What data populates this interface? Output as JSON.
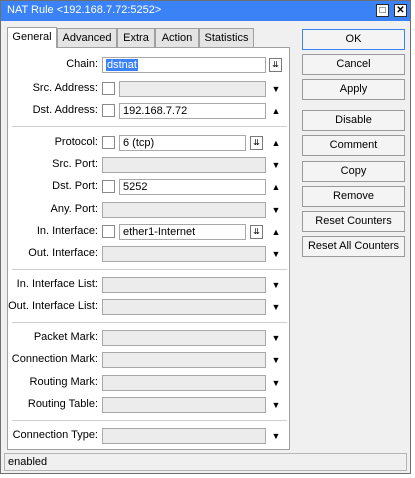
{
  "window": {
    "title": "NAT Rule <192.168.7.72:5252>",
    "restore_glyph": "□",
    "close_glyph": "✕"
  },
  "tabs": [
    "General",
    "Advanced",
    "Extra",
    "Action",
    "Statistics"
  ],
  "form": {
    "chain": {
      "label": "Chain:",
      "value": "dstnat"
    },
    "src_address": {
      "label": "Src. Address:",
      "value": ""
    },
    "dst_address": {
      "label": "Dst. Address:",
      "value": "192.168.7.72"
    },
    "protocol": {
      "label": "Protocol:",
      "value": "6 (tcp)"
    },
    "src_port": {
      "label": "Src. Port:",
      "value": ""
    },
    "dst_port": {
      "label": "Dst. Port:",
      "value": "5252"
    },
    "any_port": {
      "label": "Any. Port:",
      "value": ""
    },
    "in_interface": {
      "label": "In. Interface:",
      "value": "ether1-Internet"
    },
    "out_interface": {
      "label": "Out. Interface:",
      "value": ""
    },
    "in_interface_list": {
      "label": "In. Interface List:",
      "value": ""
    },
    "out_interface_list": {
      "label": "Out. Interface List:",
      "value": ""
    },
    "packet_mark": {
      "label": "Packet Mark:",
      "value": ""
    },
    "connection_mark": {
      "label": "Connection Mark:",
      "value": ""
    },
    "routing_mark": {
      "label": "Routing Mark:",
      "value": ""
    },
    "routing_table": {
      "label": "Routing Table:",
      "value": ""
    },
    "connection_type": {
      "label": "Connection Type:",
      "value": ""
    }
  },
  "buttons": {
    "ok": "OK",
    "cancel": "Cancel",
    "apply": "Apply",
    "disable": "Disable",
    "comment": "Comment",
    "copy": "Copy",
    "remove": "Remove",
    "reset_counters": "Reset Counters",
    "reset_all_counters": "Reset All Counters"
  },
  "glyphs": {
    "dropdown": "▼",
    "expand": "▲",
    "combo": "⇊"
  },
  "status": "enabled",
  "colors": {
    "titlebar": "#3a82f6",
    "selection": "#3a82f6"
  }
}
